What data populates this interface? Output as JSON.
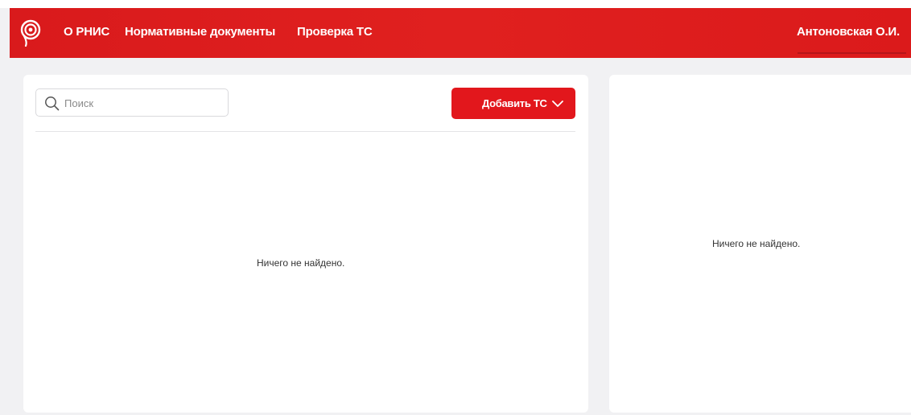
{
  "header": {
    "nav": [
      {
        "label": "О РНИС"
      },
      {
        "label": "Нормативные документы"
      },
      {
        "label": "Проверка ТС"
      }
    ],
    "user_name": "Антоновская О.И.",
    "logo_icon": "rnis-logo-icon"
  },
  "left_panel": {
    "search": {
      "placeholder": "Поиск",
      "value": ""
    },
    "add_button_label": "Добавить ТС",
    "empty_message": "Ничего не найдено."
  },
  "right_panel": {
    "empty_message": "Ничего не найдено."
  },
  "colors": {
    "brand_red": "#e2171c",
    "background": "#f1f1f3",
    "panel": "#ffffff"
  }
}
